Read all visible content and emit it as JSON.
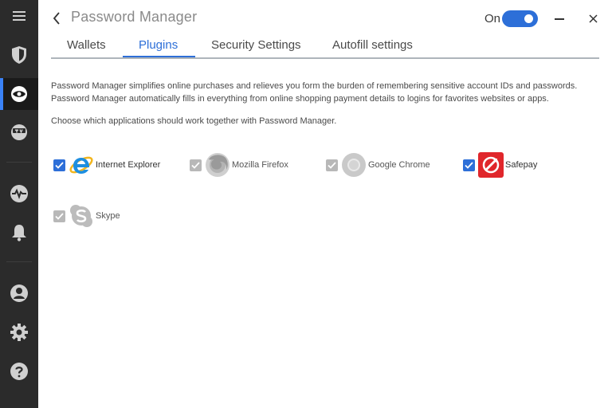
{
  "window": {
    "title": "Password Manager",
    "toggle_label": "On",
    "toggle_state": true
  },
  "sidebar": {
    "items": [
      {
        "name": "menu",
        "icon": "hamburger-menu-icon"
      },
      {
        "name": "protection",
        "icon": "shield-icon"
      },
      {
        "name": "privacy",
        "icon": "eye-icon",
        "active": true
      },
      {
        "name": "utilities",
        "icon": "tv-icon"
      },
      {
        "name": "activity",
        "icon": "activity-pulse-icon"
      },
      {
        "name": "notifications",
        "icon": "bell-icon"
      },
      {
        "name": "account",
        "icon": "user-icon"
      },
      {
        "name": "settings",
        "icon": "gear-icon"
      },
      {
        "name": "help",
        "icon": "help-icon"
      }
    ]
  },
  "tabs": [
    {
      "label": "Wallets",
      "active": false
    },
    {
      "label": "Plugins",
      "active": true
    },
    {
      "label": "Security Settings",
      "active": false
    },
    {
      "label": "Autofill settings",
      "active": false
    }
  ],
  "content": {
    "description": "Password Manager simplifies online purchases and relieves you form the burden of remembering sensitive account IDs and passwords. Password Manager automatically fills in everything from online shopping payment details to logins for favorites websites or apps.",
    "instruction": "Choose which applications should work together with Password Manager."
  },
  "plugins": [
    {
      "label": "Internet Explorer",
      "checked": true,
      "enabled": true,
      "icon": "internet-explorer-icon"
    },
    {
      "label": "Mozilla Firefox",
      "checked": true,
      "enabled": false,
      "icon": "firefox-icon"
    },
    {
      "label": "Google Chrome",
      "checked": true,
      "enabled": false,
      "icon": "chrome-icon"
    },
    {
      "label": "Safepay",
      "checked": true,
      "enabled": true,
      "icon": "safepay-icon"
    },
    {
      "label": "Skype",
      "checked": true,
      "enabled": false,
      "icon": "skype-icon"
    }
  ],
  "colors": {
    "accent": "#2d6fd8",
    "sidebar_bg": "#2b2b2b",
    "sidebar_active": "#3a82f7",
    "disabled_checkbox": "#b8b8b8",
    "safepay_red": "#e0262b"
  }
}
